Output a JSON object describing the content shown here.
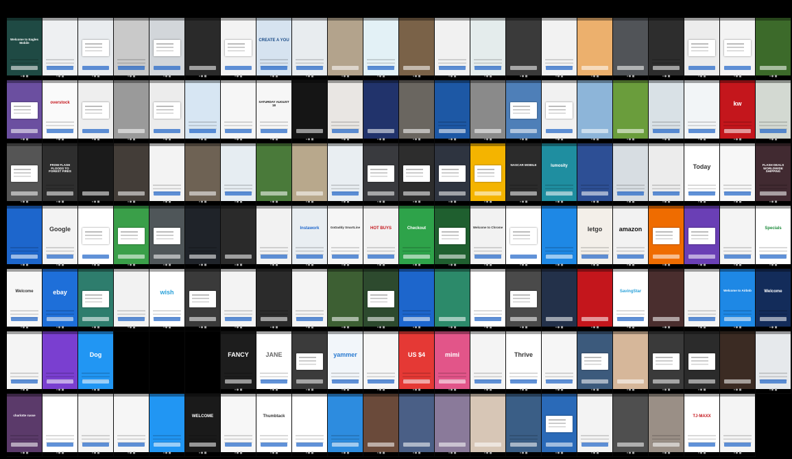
{
  "tiles": [
    {
      "bg": "#1f4a44",
      "fg": "#fff",
      "label": "Welcome to Eagles Mobile",
      "variant": "text"
    },
    {
      "bg": "#eef0f2",
      "fg": "#333",
      "label": "",
      "variant": "plain"
    },
    {
      "bg": "#e9ecef",
      "fg": "#c4161c",
      "label": "",
      "variant": "dialog"
    },
    {
      "bg": "#c9c9c9",
      "fg": "#333",
      "label": "",
      "variant": "plain"
    },
    {
      "bg": "#d2d6da",
      "fg": "#333",
      "label": "",
      "variant": "dialog"
    },
    {
      "bg": "#2a2a2a",
      "fg": "#fff",
      "label": "",
      "variant": "photo"
    },
    {
      "bg": "#f3f3f3",
      "fg": "#333",
      "label": "",
      "variant": "dialog"
    },
    {
      "bg": "#d6e3f0",
      "fg": "#1d4e89",
      "label": "CREATE A YOU",
      "variant": "text"
    },
    {
      "bg": "#e8ecef",
      "fg": "#333",
      "label": "",
      "variant": "plain"
    },
    {
      "bg": "#b3a38c",
      "fg": "#fff",
      "label": "",
      "variant": "photo"
    },
    {
      "bg": "#e3f1f6",
      "fg": "#333",
      "label": "",
      "variant": "plain"
    },
    {
      "bg": "#7a6248",
      "fg": "#fff",
      "label": "",
      "variant": "photo"
    },
    {
      "bg": "#f1f1f1",
      "fg": "#c4161c",
      "label": "",
      "variant": "plain"
    },
    {
      "bg": "#e4ecec",
      "fg": "#333",
      "label": "",
      "variant": "plain"
    },
    {
      "bg": "#3a3a3a",
      "fg": "#fff",
      "label": "",
      "variant": "photo"
    },
    {
      "bg": "#f2f2f2",
      "fg": "#333",
      "label": "",
      "variant": "plain"
    },
    {
      "bg": "#ecb06d",
      "fg": "#fff",
      "label": "",
      "variant": "photo"
    },
    {
      "bg": "#515458",
      "fg": "#fff",
      "label": "",
      "variant": "photo"
    },
    {
      "bg": "#2d2d2d",
      "fg": "#fff",
      "label": "",
      "variant": "plain"
    },
    {
      "bg": "#ececec",
      "fg": "#333",
      "label": "",
      "variant": "dialog"
    },
    {
      "bg": "#f3f3f3",
      "fg": "#333",
      "label": "",
      "variant": "dialog"
    },
    {
      "bg": "#3c6a2a",
      "fg": "#fff",
      "label": "",
      "variant": "photo"
    },
    {
      "bg": "#6b4fa0",
      "fg": "#fff",
      "label": "",
      "variant": "dialog"
    },
    {
      "bg": "#fafafa",
      "fg": "#c4161c",
      "label": "overstock",
      "variant": "text"
    },
    {
      "bg": "#eeeeee",
      "fg": "#333",
      "label": "",
      "variant": "dialog"
    },
    {
      "bg": "#9a9a9a",
      "fg": "#fff",
      "label": "",
      "variant": "photo"
    },
    {
      "bg": "#ececec",
      "fg": "#333",
      "label": "",
      "variant": "dialog"
    },
    {
      "bg": "#d7e6f3",
      "fg": "#333",
      "label": "",
      "variant": "plain"
    },
    {
      "bg": "#f6f6f6",
      "fg": "#111",
      "label": "",
      "variant": "plain"
    },
    {
      "bg": "#f6f6f6",
      "fg": "#111",
      "label": "SATURDAY AUGUST 18",
      "variant": "text"
    },
    {
      "bg": "#151515",
      "fg": "#fff",
      "label": "",
      "variant": "photo"
    },
    {
      "bg": "#e9e6e3",
      "fg": "#333",
      "label": "",
      "variant": "plain"
    },
    {
      "bg": "#21336b",
      "fg": "#fff",
      "label": "",
      "variant": "photo"
    },
    {
      "bg": "#6a6660",
      "fg": "#fff",
      "label": "",
      "variant": "photo"
    },
    {
      "bg": "#1d58a5",
      "fg": "#fff",
      "label": "",
      "variant": "text"
    },
    {
      "bg": "#8a8a8a",
      "fg": "#fff",
      "label": "",
      "variant": "photo"
    },
    {
      "bg": "#4e7fb8",
      "fg": "#fff",
      "label": "",
      "variant": "dialog"
    },
    {
      "bg": "#f1f1f1",
      "fg": "#333",
      "label": "",
      "variant": "dialog"
    },
    {
      "bg": "#8db5d9",
      "fg": "#fff",
      "label": "",
      "variant": "photo"
    },
    {
      "bg": "#6a9d3c",
      "fg": "#fff",
      "label": "",
      "variant": "photo"
    },
    {
      "bg": "#d9e1e6",
      "fg": "#333",
      "label": "",
      "variant": "plain"
    },
    {
      "bg": "#f2f5f7",
      "fg": "#333",
      "label": "",
      "variant": "plain"
    },
    {
      "bg": "#c4161c",
      "fg": "#fff",
      "label": "kw",
      "variant": "text"
    },
    {
      "bg": "#d3d9d2",
      "fg": "#333",
      "label": "",
      "variant": "plain"
    },
    {
      "bg": "#555555",
      "fg": "#fff",
      "label": "",
      "variant": "dialog"
    },
    {
      "bg": "#2e2e2e",
      "fg": "#fff",
      "label": "FROM FLASH FLOODS TO FOREST FIRES",
      "variant": "text"
    },
    {
      "bg": "#1b1b1b",
      "fg": "#fff",
      "label": "",
      "variant": "photo"
    },
    {
      "bg": "#433d38",
      "fg": "#fff",
      "label": "",
      "variant": "photo"
    },
    {
      "bg": "#f3f3f3",
      "fg": "#333",
      "label": "",
      "variant": "plain"
    },
    {
      "bg": "#6e6254",
      "fg": "#fff",
      "label": "",
      "variant": "photo"
    },
    {
      "bg": "#e6edf2",
      "fg": "#333",
      "label": "",
      "variant": "plain"
    },
    {
      "bg": "#4a7a3a",
      "fg": "#fff",
      "label": "",
      "variant": "photo"
    },
    {
      "bg": "#b8a88c",
      "fg": "#fff",
      "label": "",
      "variant": "photo"
    },
    {
      "bg": "#e9eef2",
      "fg": "#333",
      "label": "",
      "variant": "plain"
    },
    {
      "bg": "#393a3e",
      "fg": "#fff",
      "label": "",
      "variant": "dialog"
    },
    {
      "bg": "#2d2d2d",
      "fg": "#fff",
      "label": "",
      "variant": "dialog"
    },
    {
      "bg": "#2e3440",
      "fg": "#fff",
      "label": "",
      "variant": "dialog"
    },
    {
      "bg": "#f4b400",
      "fg": "#fff",
      "label": "",
      "variant": "dialog"
    },
    {
      "bg": "#2b2b2b",
      "fg": "#fff",
      "label": "NASCAR MOBILE",
      "variant": "text"
    },
    {
      "bg": "#1f8ea0",
      "fg": "#fff",
      "label": "lumosity",
      "variant": "text"
    },
    {
      "bg": "#2d4f95",
      "fg": "#fff",
      "label": "",
      "variant": "plain"
    },
    {
      "bg": "#d7dde2",
      "fg": "#333",
      "label": "",
      "variant": "plain"
    },
    {
      "bg": "#ececec",
      "fg": "#333",
      "label": "",
      "variant": "plain"
    },
    {
      "bg": "#ffffff",
      "fg": "#333",
      "label": "Today",
      "variant": "text"
    },
    {
      "bg": "#f7f7f7",
      "fg": "#333",
      "label": "",
      "variant": "plain"
    },
    {
      "bg": "#412a31",
      "fg": "#fff",
      "label": "FLASH DEALS WORLDWIDE SHIPPING",
      "variant": "text"
    },
    {
      "bg": "#1d66cc",
      "fg": "#fff",
      "label": "",
      "variant": "plain"
    },
    {
      "bg": "#f3f3f3",
      "fg": "#333",
      "label": "Google",
      "variant": "text"
    },
    {
      "bg": "#ffffff",
      "fg": "#333",
      "label": "",
      "variant": "dialog"
    },
    {
      "bg": "#3a9f49",
      "fg": "#fff",
      "label": "",
      "variant": "dialog"
    },
    {
      "bg": "#4f5659",
      "fg": "#fff",
      "label": "",
      "variant": "dialog"
    },
    {
      "bg": "#1f2329",
      "fg": "#fff",
      "label": "",
      "variant": "plain"
    },
    {
      "bg": "#2a2a2a",
      "fg": "#fff",
      "label": "",
      "variant": "photo"
    },
    {
      "bg": "#f2f2f2",
      "fg": "#333",
      "label": "",
      "variant": "plain"
    },
    {
      "bg": "#e9eef2",
      "fg": "#1d66cc",
      "label": "Instawork",
      "variant": "text"
    },
    {
      "bg": "#f6f6f6",
      "fg": "#333",
      "label": "GoDaddy SmartLine",
      "variant": "text"
    },
    {
      "bg": "#f2f2f2",
      "fg": "#c4161c",
      "label": "HOT BUYS",
      "variant": "text"
    },
    {
      "bg": "#2ea34a",
      "fg": "#fff",
      "label": "Checkout",
      "variant": "text"
    },
    {
      "bg": "#1f5f2f",
      "fg": "#fff",
      "label": "",
      "variant": "dialog"
    },
    {
      "bg": "#f2f2f2",
      "fg": "#333",
      "label": "Welcome to Chrome",
      "variant": "text"
    },
    {
      "bg": "#ffffff",
      "fg": "#333",
      "label": "",
      "variant": "dialog"
    },
    {
      "bg": "#1e88e5",
      "fg": "#fff",
      "label": "",
      "variant": "plain"
    },
    {
      "bg": "#f3efe9",
      "fg": "#333",
      "label": "letgo",
      "variant": "text"
    },
    {
      "bg": "#f2f2f2",
      "fg": "#111",
      "label": "amazon",
      "variant": "text"
    },
    {
      "bg": "#ef6c00",
      "fg": "#fff",
      "label": "",
      "variant": "dialog"
    },
    {
      "bg": "#6a3fb5",
      "fg": "#fff",
      "label": "",
      "variant": "dialog"
    },
    {
      "bg": "#f4f4f4",
      "fg": "#333",
      "label": "",
      "variant": "plain"
    },
    {
      "bg": "#ffffff",
      "fg": "#1b8a3a",
      "label": "Specials",
      "variant": "text"
    },
    {
      "bg": "#f7f7f7",
      "fg": "#333",
      "label": "Welcome",
      "variant": "text"
    },
    {
      "bg": "#1e6fd9",
      "fg": "#fff",
      "label": "ebay",
      "variant": "text"
    },
    {
      "bg": "#2e7d6d",
      "fg": "#fff",
      "label": "",
      "variant": "dialog"
    },
    {
      "bg": "#f2f2f2",
      "fg": "#333",
      "label": "",
      "variant": "plain"
    },
    {
      "bg": "#ffffff",
      "fg": "#2aa1d9",
      "label": "wish",
      "variant": "text"
    },
    {
      "bg": "#3a3a3a",
      "fg": "#fff",
      "label": "",
      "variant": "dialog"
    },
    {
      "bg": "#f3f3f3",
      "fg": "#333",
      "label": "",
      "variant": "plain"
    },
    {
      "bg": "#2b2b2b",
      "fg": "#fff",
      "label": "",
      "variant": "plain"
    },
    {
      "bg": "#f4f4f4",
      "fg": "#333",
      "label": "",
      "variant": "plain"
    },
    {
      "bg": "#3d5f33",
      "fg": "#fff",
      "label": "",
      "variant": "photo"
    },
    {
      "bg": "#2d4a2e",
      "fg": "#fff",
      "label": "",
      "variant": "dialog"
    },
    {
      "bg": "#1d66cc",
      "fg": "#fff",
      "label": "",
      "variant": "plain"
    },
    {
      "bg": "#2c8a6a",
      "fg": "#fff",
      "label": "",
      "variant": "photo"
    },
    {
      "bg": "#ffffff",
      "fg": "#c4161c",
      "label": "",
      "variant": "plain"
    },
    {
      "bg": "#4a4a4a",
      "fg": "#fff",
      "label": "",
      "variant": "dialog"
    },
    {
      "bg": "#23314a",
      "fg": "#fff",
      "label": "",
      "variant": "photo"
    },
    {
      "bg": "#c4161c",
      "fg": "#fff",
      "label": "",
      "variant": "photo"
    },
    {
      "bg": "#ffffff",
      "fg": "#2aa1d9",
      "label": "SavingStar",
      "variant": "text"
    },
    {
      "bg": "#4a2e2e",
      "fg": "#fff",
      "label": "",
      "variant": "photo"
    },
    {
      "bg": "#f3f3f3",
      "fg": "#333",
      "label": "",
      "variant": "plain"
    },
    {
      "bg": "#1e88e5",
      "fg": "#fff",
      "label": "Welcome to Airbnb",
      "variant": "text"
    },
    {
      "bg": "#132c5a",
      "fg": "#fff",
      "label": "Welcome",
      "variant": "text"
    },
    {
      "bg": "#f4f4f4",
      "fg": "#333",
      "label": "",
      "variant": "plain"
    },
    {
      "bg": "#7a3fd0",
      "fg": "#fff",
      "label": "",
      "variant": "plain"
    },
    {
      "bg": "#2196f3",
      "fg": "#fff",
      "label": "Dog",
      "variant": "text"
    },
    {
      "bg": "#000000",
      "fg": "#000",
      "label": "",
      "variant": "empty"
    },
    {
      "bg": "#000000",
      "fg": "#000",
      "label": "",
      "variant": "empty"
    },
    {
      "bg": "#000000",
      "fg": "#000",
      "label": "",
      "variant": "empty"
    },
    {
      "bg": "#1d1d1d",
      "fg": "#fff",
      "label": "FANCY",
      "variant": "text"
    },
    {
      "bg": "#ffffff",
      "fg": "#666",
      "label": "JANE",
      "variant": "text"
    },
    {
      "bg": "#3b3b3b",
      "fg": "#fff",
      "label": "",
      "variant": "dialog"
    },
    {
      "bg": "#f2f6fa",
      "fg": "#2a7bd1",
      "label": "yammer",
      "variant": "text"
    },
    {
      "bg": "#f6f6f6",
      "fg": "#333",
      "label": "",
      "variant": "plain"
    },
    {
      "bg": "#e53935",
      "fg": "#fff",
      "label": "US $4",
      "variant": "text"
    },
    {
      "bg": "#e25589",
      "fg": "#fff",
      "label": "mimi",
      "variant": "text"
    },
    {
      "bg": "#f4f4f4",
      "fg": "#333",
      "label": "",
      "variant": "plain"
    },
    {
      "bg": "#ffffff",
      "fg": "#333",
      "label": "Thrive",
      "variant": "text"
    },
    {
      "bg": "#f6f6f6",
      "fg": "#333",
      "label": "",
      "variant": "plain"
    },
    {
      "bg": "#3c5a7c",
      "fg": "#fff",
      "label": "",
      "variant": "dialog"
    },
    {
      "bg": "#d6b79a",
      "fg": "#fff",
      "label": "",
      "variant": "photo"
    },
    {
      "bg": "#3a3a3a",
      "fg": "#fff",
      "label": "",
      "variant": "dialog"
    },
    {
      "bg": "#2b2b2b",
      "fg": "#fff",
      "label": "",
      "variant": "dialog"
    },
    {
      "bg": "#3b2b23",
      "fg": "#fff",
      "label": "",
      "variant": "photo"
    },
    {
      "bg": "#e6e9ec",
      "fg": "#333",
      "label": "",
      "variant": "plain"
    },
    {
      "bg": "#5b3a6a",
      "fg": "#fff",
      "label": "charlotte russe",
      "variant": "text"
    },
    {
      "bg": "#ffffff",
      "fg": "#333",
      "label": "",
      "variant": "plain"
    },
    {
      "bg": "#f4f4f4",
      "fg": "#333",
      "label": "",
      "variant": "plain"
    },
    {
      "bg": "#f6f6f6",
      "fg": "#333",
      "label": "",
      "variant": "plain"
    },
    {
      "bg": "#2196f3",
      "fg": "#fff",
      "label": "",
      "variant": "plain"
    },
    {
      "bg": "#1a1a1a",
      "fg": "#fff",
      "label": "WELCOME",
      "variant": "text"
    },
    {
      "bg": "#f7f7f7",
      "fg": "#333",
      "label": "",
      "variant": "plain"
    },
    {
      "bg": "#ffffff",
      "fg": "#333",
      "label": "Thumbtack",
      "variant": "text"
    },
    {
      "bg": "#ffffff",
      "fg": "#1d66cc",
      "label": "",
      "variant": "plain"
    },
    {
      "bg": "#2d8cdf",
      "fg": "#fff",
      "label": "",
      "variant": "plain"
    },
    {
      "bg": "#6a4a3a",
      "fg": "#fff",
      "label": "",
      "variant": "photo"
    },
    {
      "bg": "#4a5f86",
      "fg": "#fff",
      "label": "",
      "variant": "photo"
    },
    {
      "bg": "#8a7a9a",
      "fg": "#fff",
      "label": "",
      "variant": "photo"
    },
    {
      "bg": "#d7c6b6",
      "fg": "#fff",
      "label": "",
      "variant": "photo"
    },
    {
      "bg": "#3a5e86",
      "fg": "#fff",
      "label": "",
      "variant": "plain"
    },
    {
      "bg": "#2a6ab8",
      "fg": "#fff",
      "label": "",
      "variant": "dialog"
    },
    {
      "bg": "#f3f3f3",
      "fg": "#333",
      "label": "",
      "variant": "plain"
    },
    {
      "bg": "#4f4f4f",
      "fg": "#fff",
      "label": "",
      "variant": "photo"
    },
    {
      "bg": "#9a8f86",
      "fg": "#fff",
      "label": "",
      "variant": "plain"
    },
    {
      "bg": "#ffffff",
      "fg": "#c4161c",
      "label": "TJ·MAXX",
      "variant": "text"
    },
    {
      "bg": "#f4f4f4",
      "fg": "#333",
      "label": "",
      "variant": "plain"
    }
  ]
}
